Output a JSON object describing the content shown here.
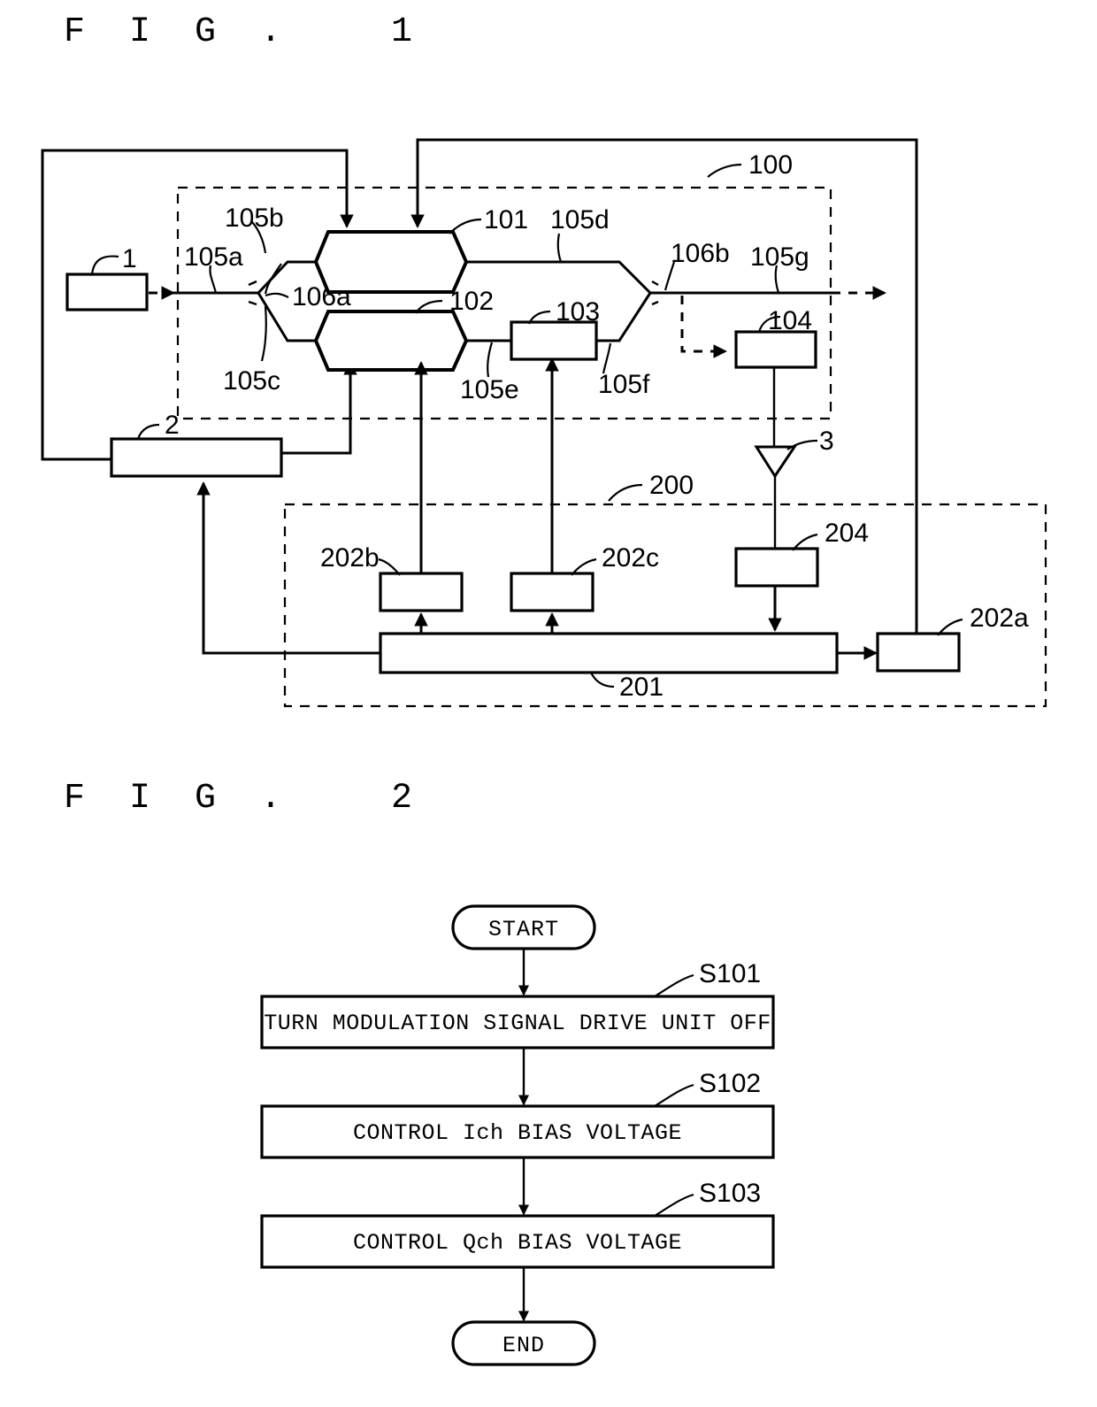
{
  "figures": {
    "fig1": {
      "title": "F I G .   1",
      "refs": {
        "r1": "1",
        "r2": "2",
        "r3": "3",
        "r100": "100",
        "r101": "101",
        "r102": "102",
        "r103": "103",
        "r104": "104",
        "r105a": "105a",
        "r105b": "105b",
        "r105c": "105c",
        "r105d": "105d",
        "r105e": "105e",
        "r105f": "105f",
        "r105g": "105g",
        "r106a": "106a",
        "r106b": "106b",
        "r200": "200",
        "r201": "201",
        "r202a": "202a",
        "r202b": "202b",
        "r202c": "202c",
        "r204": "204"
      }
    },
    "fig2": {
      "title": "F I G .   2",
      "nodes": {
        "start": "START",
        "s101": "TURN MODULATION SIGNAL DRIVE UNIT OFF",
        "s102": "CONTROL Ich BIAS VOLTAGE",
        "s103": "CONTROL Qch BIAS VOLTAGE",
        "end": "END"
      },
      "steps": {
        "s101_ref": "S101",
        "s102_ref": "S102",
        "s103_ref": "S103"
      }
    }
  },
  "colors": {
    "ink": "#000000",
    "paper": "#ffffff"
  }
}
